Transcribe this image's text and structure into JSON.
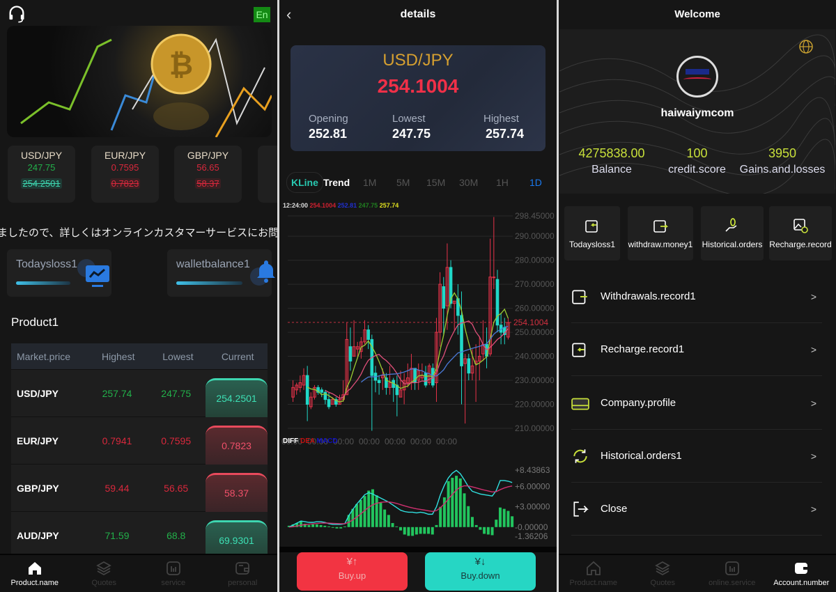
{
  "home": {
    "lang_label": "En",
    "tickers": [
      {
        "pair": "USD/JPY",
        "low": "247.75",
        "current": "254.2501",
        "trend": "up"
      },
      {
        "pair": "EUR/JPY",
        "low": "0.7595",
        "current": "0.7823",
        "trend": "down"
      },
      {
        "pair": "GBP/JPY",
        "low": "56.65",
        "current": "58.37",
        "trend": "down"
      }
    ],
    "marquee": "ましたので、詳しくはオンラインカスタマーサービスにお問い合わ",
    "stats": [
      {
        "label": "Todaysloss1"
      },
      {
        "label": "walletbalance1"
      }
    ],
    "section_title": "Product1",
    "table": {
      "headers": [
        "Market.price",
        "Highest",
        "Lowest",
        "Current"
      ],
      "rows": [
        {
          "pair": "USD/JPY",
          "high": "257.74",
          "low": "247.75",
          "current": "254.2501",
          "trend": "up"
        },
        {
          "pair": "EUR/JPY",
          "high": "0.7941",
          "low": "0.7595",
          "current": "0.7823",
          "trend": "down"
        },
        {
          "pair": "GBP/JPY",
          "high": "59.44",
          "low": "56.65",
          "current": "58.37",
          "trend": "down"
        },
        {
          "pair": "AUD/JPY",
          "high": "71.59",
          "low": "68.8",
          "current": "69.9301",
          "trend": "up"
        }
      ]
    },
    "nav": [
      {
        "label": "Product.name",
        "icon": "home-icon"
      },
      {
        "label": "Quotes",
        "icon": "layers-icon"
      },
      {
        "label": "service",
        "icon": "chart-icon"
      },
      {
        "label": "personal",
        "icon": "wallet-icon"
      }
    ]
  },
  "details": {
    "title": "details",
    "pair": "USD/JPY",
    "price": "254.1004",
    "opening_label": "Opening",
    "opening": "252.81",
    "lowest_label": "Lowest",
    "lowest": "247.75",
    "highest_label": "Highest",
    "highest": "257.74",
    "tabs": [
      "KLine",
      "Trend",
      "1M",
      "5M",
      "15M",
      "30M",
      "1H",
      "1D"
    ],
    "active_tab": "1D",
    "info": {
      "time": "12:24:00",
      "price": "254.1004",
      "open": "252.81",
      "low": "247.75",
      "high": "257.74"
    },
    "macd_legend": [
      "DIFF",
      "DEA",
      "MACD"
    ],
    "buy_up": "Buy.up",
    "buy_down": "Buy.down",
    "colors": {
      "up": "#e8334a",
      "down": "#20d8c8",
      "ma5": "#9acd32",
      "ma10": "#e0507a",
      "ma30": "#4a7ad8"
    }
  },
  "chart_data": {
    "type": "candlestick",
    "ylim": [
      210,
      298.45
    ],
    "y_ticks": [
      "298.45000",
      "290.00000",
      "280.00000",
      "270.00000",
      "260.00000",
      "250.00000",
      "240.00000",
      "230.00000",
      "220.00000",
      "210.00000"
    ],
    "last_price": "254.1004",
    "x_ticks": [
      "00:00",
      "00:00",
      "00:00",
      "00:00",
      "00:00",
      "00:00",
      "00:00"
    ],
    "ohlc": [
      [
        223,
        227,
        230,
        221
      ],
      [
        226,
        228,
        229,
        224
      ],
      [
        227,
        229,
        232,
        225
      ],
      [
        228,
        232,
        235,
        226
      ],
      [
        232,
        220,
        236,
        213
      ],
      [
        219,
        223,
        225,
        218
      ],
      [
        223,
        227,
        228,
        222
      ],
      [
        227,
        225,
        228,
        224
      ],
      [
        226,
        225,
        227,
        223
      ],
      [
        225,
        222,
        226,
        220
      ],
      [
        222,
        219,
        225,
        218
      ],
      [
        220,
        222,
        223,
        220
      ],
      [
        222,
        220,
        223,
        219
      ],
      [
        220,
        222,
        224,
        220
      ],
      [
        222,
        224,
        230,
        221
      ],
      [
        224,
        247,
        254,
        224
      ],
      [
        244,
        238,
        252,
        234
      ],
      [
        240,
        244,
        255,
        240
      ],
      [
        243,
        244,
        246,
        240
      ],
      [
        242,
        246,
        248,
        239
      ],
      [
        246,
        251,
        255,
        245
      ],
      [
        251,
        247,
        253,
        243
      ],
      [
        247,
        232,
        249,
        209
      ],
      [
        233,
        230,
        236,
        225
      ],
      [
        230,
        229,
        232,
        224
      ],
      [
        231,
        232,
        235,
        226
      ],
      [
        231,
        227,
        233,
        224
      ],
      [
        227,
        229,
        236,
        224
      ],
      [
        230,
        227,
        231,
        221
      ],
      [
        228,
        224,
        232,
        215
      ],
      [
        223,
        226,
        234,
        223
      ],
      [
        226,
        230,
        233,
        220
      ],
      [
        229,
        231,
        237,
        227
      ],
      [
        229,
        235,
        241,
        226
      ],
      [
        235,
        229,
        235,
        226
      ],
      [
        230,
        234,
        237,
        226
      ],
      [
        231,
        232,
        237,
        230
      ],
      [
        233,
        228,
        236,
        227
      ],
      [
        229,
        236,
        237,
        228
      ],
      [
        235,
        228,
        237,
        227
      ],
      [
        229,
        250,
        256,
        221
      ],
      [
        250,
        270,
        275,
        244
      ],
      [
        269,
        260,
        273,
        249
      ],
      [
        261,
        277,
        287,
        251
      ],
      [
        277,
        262,
        280,
        260
      ],
      [
        262,
        263,
        263,
        251
      ],
      [
        264,
        257,
        270,
        249
      ],
      [
        257,
        236,
        267,
        220
      ],
      [
        237,
        239,
        241,
        212
      ],
      [
        239,
        233,
        241,
        230
      ],
      [
        233,
        236,
        243,
        230
      ],
      [
        237,
        238,
        245,
        221
      ],
      [
        238,
        240,
        248,
        230
      ],
      [
        241,
        245,
        255,
        238
      ],
      [
        245,
        240,
        252,
        235
      ],
      [
        241,
        273,
        289,
        240
      ],
      [
        273,
        273,
        298,
        268
      ],
      [
        272,
        253,
        276,
        250
      ],
      [
        253,
        250,
        258,
        245
      ],
      [
        252,
        249,
        256,
        245
      ],
      [
        248,
        254,
        256,
        247
      ]
    ],
    "macd": {
      "ylim": [
        -1.36206,
        8.43863
      ],
      "y_ticks": [
        "+8.43863",
        "+6.00000",
        "+3.00000",
        "-0.00000",
        "-1.36206"
      ],
      "hist": [
        0.2,
        0.4,
        0.6,
        0.9,
        0.5,
        0.3,
        0.4,
        0.4,
        0.3,
        0.2,
        0.1,
        -0.1,
        -0.2,
        -0.2,
        0.1,
        1.8,
        2.7,
        3.4,
        4.0,
        4.6,
        5.4,
        5.6,
        4.7,
        3.6,
        2.6,
        1.8,
        0.6,
        0.1,
        -0.5,
        -1.1,
        -1.3,
        -1.3,
        -1.1,
        -1.0,
        -1.0,
        -1.0,
        -1.1,
        0.3,
        3.0,
        4.4,
        6.8,
        7.3,
        7.6,
        7.2,
        5.0,
        3.1,
        1.5,
        0.3,
        -0.4,
        -1.0,
        -1.1,
        -1.2,
        1.1,
        2.9,
        2.7,
        2.4,
        1.6
      ],
      "diff": [
        0,
        0.3,
        0.6,
        0.9,
        0.8,
        0.7,
        0.7,
        0.8,
        0.8,
        0.7,
        0.5,
        0.4,
        0.4,
        0.4,
        0.5,
        1.7,
        2.6,
        3.4,
        4.1,
        4.8,
        5.1,
        4.9,
        4.6,
        4.3,
        4.0,
        3.7,
        3.3,
        2.9,
        2.5,
        2.3,
        2.2,
        2.2,
        2.1,
        2.2,
        2.1,
        1.9,
        1.9,
        3.0,
        4.8,
        6.2,
        7.3,
        8.0,
        8.4,
        7.9,
        7.0,
        6.0,
        5.3,
        5.1,
        4.9,
        4.8,
        4.7,
        4.6,
        5.4,
        6.9,
        6.9,
        6.8,
        6.6
      ]
    }
  },
  "account": {
    "title": "Welcome",
    "username": "haiwaiymcom",
    "stats": [
      {
        "value": "4275838.00",
        "label": "Balance"
      },
      {
        "value": "100",
        "label": "credit.score"
      },
      {
        "value": "3950",
        "label": "Gains.and.losses"
      }
    ],
    "tiles": [
      {
        "label": "Todaysloss1"
      },
      {
        "label": "withdraw.money1"
      },
      {
        "label": "Historical.orders"
      },
      {
        "label": "Recharge.record"
      }
    ],
    "menu": [
      {
        "label": "Withdrawals.record1"
      },
      {
        "label": "Recharge.record1"
      },
      {
        "label": "Company.profile"
      },
      {
        "label": "Historical.orders1"
      },
      {
        "label": "Close"
      }
    ],
    "nav": [
      {
        "label": "Product.name"
      },
      {
        "label": "Quotes"
      },
      {
        "label": "online.service"
      },
      {
        "label": "Account.number"
      }
    ],
    "accent": "#c8e03a"
  }
}
